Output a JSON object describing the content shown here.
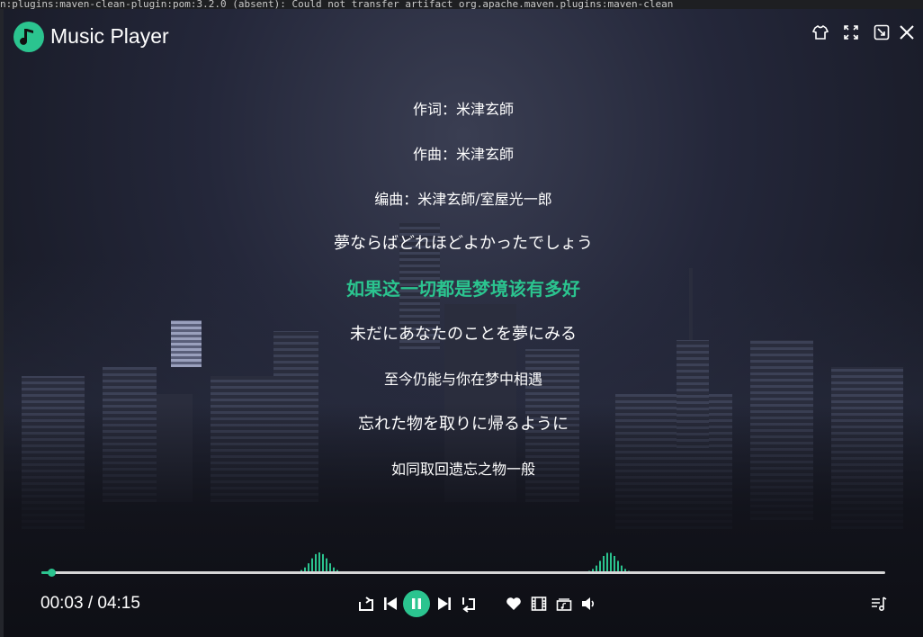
{
  "terminal": {
    "text": "n:plugins:maven-clean-plugin:pom:3.2.0 (absent): Could not transfer artifact org.apache.maven.plugins:maven-clean"
  },
  "app": {
    "title": "Music Player",
    "accent_color": "#2bc48f"
  },
  "window_controls": [
    {
      "name": "skin",
      "icon": "shirt-icon"
    },
    {
      "name": "fullscreen",
      "icon": "expand-icon"
    },
    {
      "name": "minimize",
      "icon": "minimize-to-tray-icon"
    },
    {
      "name": "close",
      "icon": "close-icon"
    }
  ],
  "lyrics": {
    "lines": [
      {
        "text": "作词：米津玄師",
        "active": false
      },
      {
        "text": "作曲：米津玄師",
        "active": false
      },
      {
        "text": "编曲：米津玄師/室屋光一郎",
        "active": false
      },
      {
        "text": "夢ならばどれほどよかったでしょう",
        "active": false
      },
      {
        "text": "如果这一切都是梦境该有多好",
        "active": true
      },
      {
        "text": "未だにあなたのことを夢にみる",
        "active": false
      },
      {
        "text": "至今仍能与你在梦中相遇",
        "active": false
      },
      {
        "text": "忘れた物を取りに帰るように",
        "active": false
      },
      {
        "text": "如同取回遗忘之物一般",
        "active": false
      }
    ]
  },
  "playback": {
    "current_time": "00:03",
    "separator": " / ",
    "total_time": "04:15",
    "progress": 0.012,
    "state": "playing"
  },
  "controls": [
    {
      "name": "loop-mode",
      "icon": "repeat-icon"
    },
    {
      "name": "previous",
      "icon": "skip-previous-icon"
    },
    {
      "name": "play-pause",
      "icon": "pause-icon"
    },
    {
      "name": "next",
      "icon": "skip-next-icon"
    },
    {
      "name": "single-repeat",
      "icon": "repeat-one-icon"
    },
    {
      "name": "favorite",
      "icon": "heart-icon"
    },
    {
      "name": "mv",
      "icon": "film-icon"
    },
    {
      "name": "lyrics-toggle",
      "icon": "lyrics-card-icon"
    },
    {
      "name": "volume",
      "icon": "speaker-icon"
    },
    {
      "name": "playlist",
      "icon": "playlist-icon"
    }
  ]
}
